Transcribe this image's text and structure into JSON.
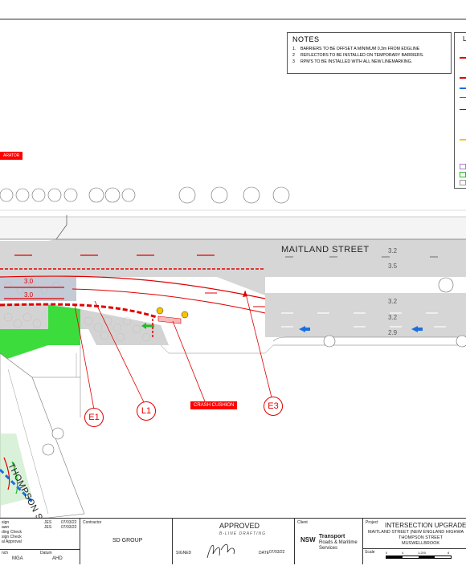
{
  "notes": {
    "title": "NOTES",
    "items": [
      {
        "num": "1.",
        "text": "BARRIERS TO BE OFFSET A MINIMUM 0.3m FROM EDGLINE"
      },
      {
        "num": "2",
        "text": "REFLECTORS TO BE INSTALLED ON TEMPORARY BARRIERS."
      },
      {
        "num": "3",
        "text": "RPM'S TO BE INSTALLED WITH ALL NEW LINEMARKING."
      }
    ]
  },
  "legend": {
    "title": "L"
  },
  "plan": {
    "street_main": "MAITLAND  STREET",
    "street_side": "THOMPSON STREET",
    "separator_label": "ARATOR",
    "widths": {
      "w1": "3.2",
      "w2": "3.5",
      "w3": "3.0",
      "w4": "3.0",
      "w5": "3.2",
      "w6": "3.2",
      "w7": "2.9"
    },
    "crash_cushion": "CRASH CUSHION",
    "refs": {
      "e1": "E1",
      "l1": "L1",
      "e3": "E3"
    }
  },
  "title_block": {
    "rev_rows": [
      {
        "label": "sign",
        "by": "JES",
        "date": "07/03/22"
      },
      {
        "label": "awn",
        "by": "JES",
        "date": "07/03/22"
      },
      {
        "label": "ding Check",
        "by": "",
        "date": ""
      },
      {
        "label": "sign Check",
        "by": "",
        "date": ""
      },
      {
        "label": "al Approval",
        "by": "",
        "date": ""
      }
    ],
    "datum": {
      "h_label": "nch",
      "h_value": "MGA",
      "v_label": "Datum",
      "v_value": "AHD"
    },
    "contractor_label": "Contractor",
    "contractor": "SD GROUP",
    "approved": "APPROVED",
    "approved_by": "B-LINE DRAFTING",
    "signed_label": "SIGNED",
    "date_label": "DATE",
    "date_value": "07/03/22",
    "client_label": "Client",
    "client_logo": "NSW",
    "client_name_1": "Transport",
    "client_name_2": "Roads & Maritime",
    "client_name_3": "Services",
    "project_label": "Project",
    "project_title": "INTERSECTION UPGRADE AT",
    "project_line_1": "MAITLAND STREET (NEW ENGLAND HIGHWA",
    "project_line_2": "THOMPSON STREET",
    "project_line_3": "MUSWELLBROOK",
    "scale_label": "Scale",
    "scale_value": "1:200",
    "scale_ticks": [
      "0",
      "4",
      "8"
    ]
  }
}
